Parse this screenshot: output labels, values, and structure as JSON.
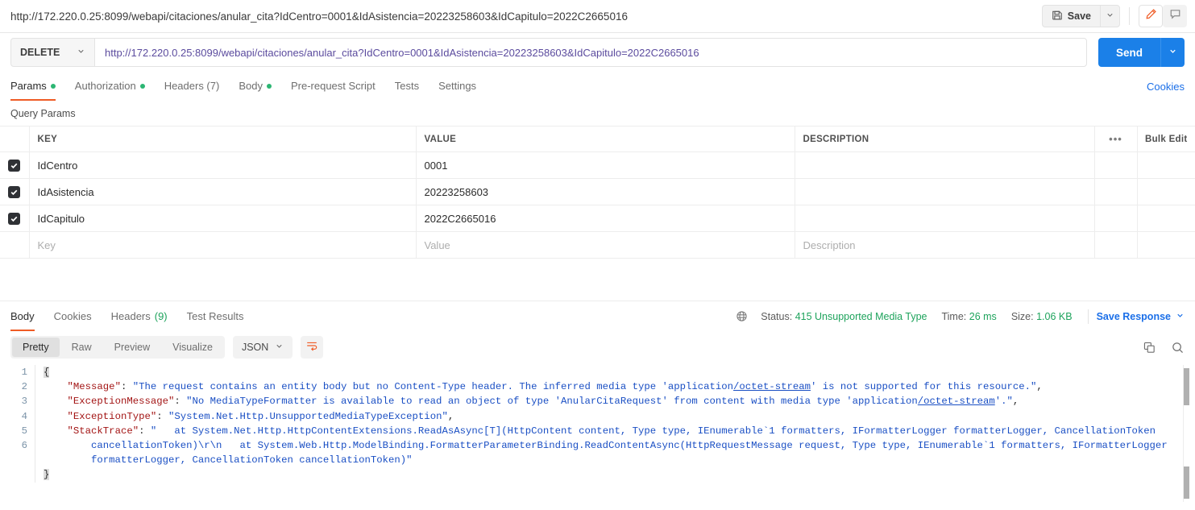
{
  "topbar": {
    "request_title": "http://172.220.0.25:8099/webapi/citaciones/anular_cita?IdCentro=0001&IdAsistencia=20223258603&IdCapitulo=2022C2665016",
    "save_label": "Save"
  },
  "url_row": {
    "method": "DELETE",
    "url": "http://172.220.0.25:8099/webapi/citaciones/anular_cita?IdCentro=0001&IdAsistencia=20223258603&IdCapitulo=2022C2665016",
    "send_label": "Send"
  },
  "request_tabs": {
    "items": [
      {
        "label": "Params",
        "dot": true,
        "active": true
      },
      {
        "label": "Authorization",
        "dot": true,
        "active": false
      },
      {
        "label": "Headers (7)",
        "dot": false,
        "active": false
      },
      {
        "label": "Body",
        "dot": true,
        "active": false
      },
      {
        "label": "Pre-request Script",
        "dot": false,
        "active": false
      },
      {
        "label": "Tests",
        "dot": false,
        "active": false
      },
      {
        "label": "Settings",
        "dot": false,
        "active": false
      }
    ],
    "cookies_label": "Cookies"
  },
  "query_params": {
    "section_label": "Query Params",
    "headers": {
      "key": "KEY",
      "value": "VALUE",
      "description": "DESCRIPTION",
      "bulk_edit": "Bulk Edit"
    },
    "rows": [
      {
        "checked": true,
        "key": "IdCentro",
        "value": "0001",
        "description": ""
      },
      {
        "checked": true,
        "key": "IdAsistencia",
        "value": "20223258603",
        "description": ""
      },
      {
        "checked": true,
        "key": "IdCapitulo",
        "value": "2022C2665016",
        "description": ""
      }
    ],
    "placeholder_row": {
      "key": "Key",
      "value": "Value",
      "description": "Description"
    }
  },
  "response": {
    "tabs": [
      {
        "label": "Body",
        "active": true
      },
      {
        "label": "Cookies",
        "active": false
      },
      {
        "label": "Headers",
        "count": "(9)",
        "active": false
      },
      {
        "label": "Test Results",
        "active": false
      }
    ],
    "status_label": "Status:",
    "status_value": "415 Unsupported Media Type",
    "time_label": "Time:",
    "time_value": "26 ms",
    "size_label": "Size:",
    "size_value": "1.06 KB",
    "save_response_label": "Save Response",
    "view_modes": [
      {
        "label": "Pretty",
        "active": true
      },
      {
        "label": "Raw",
        "active": false
      },
      {
        "label": "Preview",
        "active": false
      },
      {
        "label": "Visualize",
        "active": false
      }
    ],
    "format": "JSON",
    "body": {
      "line_numbers": [
        "1",
        "2",
        "3",
        "4",
        "5",
        "6"
      ],
      "json": {
        "Message": "The request contains an entity body but no Content-Type header. The inferred media type 'application/octet-stream' is not supported for this resource.",
        "ExceptionMessage": "No MediaTypeFormatter is available to read an object of type 'AnularCitaRequest' from content with media type 'application/octet-stream'.",
        "ExceptionType": "System.Net.Http.UnsupportedMediaTypeException",
        "StackTrace": "   at System.Net.Http.HttpContentExtensions.ReadAsAsync[T](HttpContent content, Type type, IEnumerable`1 formatters, IFormatterLogger formatterLogger, CancellationToken cancellationToken)\\r\\n   at System.Web.Http.ModelBinding.FormatterParameterBinding.ReadContentAsync(HttpRequestMessage request, Type type, IEnumerable`1 formatters, IFormatterLogger formatterLogger, CancellationToken cancellationToken)"
      }
    }
  },
  "colors": {
    "accent_orange": "#ef5b25",
    "send_blue": "#1b80e8",
    "link_blue": "#1b6fe8",
    "status_green": "#1ea35c",
    "json_key": "#a31515",
    "json_value": "#1a4fc4",
    "url_purple": "#5b4b9e"
  }
}
